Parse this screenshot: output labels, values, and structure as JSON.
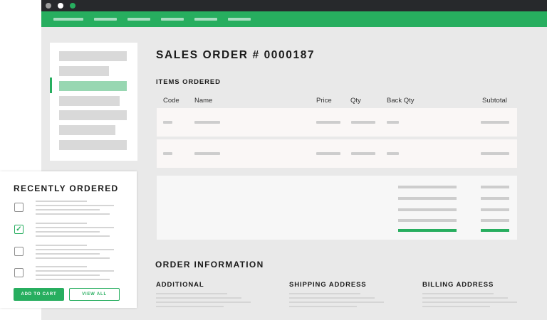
{
  "window": {
    "controls": [
      {
        "name": "close",
        "color": "#9e9e9e"
      },
      {
        "name": "minimize",
        "color": "#ffffff"
      },
      {
        "name": "maximize",
        "color": "#27ae5f"
      }
    ]
  },
  "colors": {
    "accent": "#27ae5f",
    "dark": "#27292c",
    "background": "#e9e9e9"
  },
  "order": {
    "title": "SALES ORDER # 0000187",
    "items_heading": "ITEMS ORDERED",
    "columns": [
      "Code",
      "Name",
      "Price",
      "Qty",
      "Back Qty",
      "Subtotal"
    ],
    "info_heading": "ORDER INFORMATION",
    "info_sections": [
      "ADDITIONAL",
      "SHIPPING ADDRESS",
      "BILLING ADDRESS"
    ]
  },
  "recent": {
    "title": "RECENTLY ORDERED",
    "items": [
      {
        "checked": false
      },
      {
        "checked": true,
        "check_glyph": "✓"
      },
      {
        "checked": false
      },
      {
        "checked": false
      }
    ],
    "add_to_cart": "ADD TO CART",
    "view_all": "VIEW ALL"
  }
}
